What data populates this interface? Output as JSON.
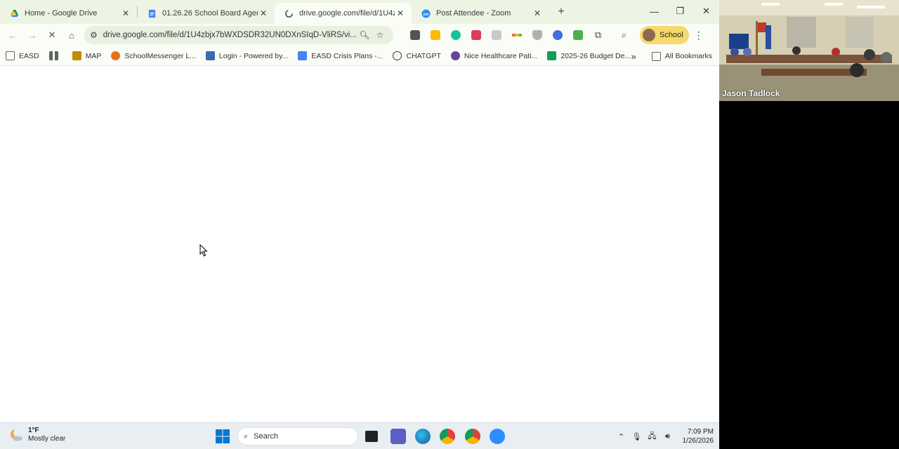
{
  "tabs": [
    {
      "title": "Home - Google Drive",
      "icon": "google-drive-icon",
      "color": "#f4b400",
      "active": false
    },
    {
      "title": "01.26.26 School Board Agenda",
      "icon": "google-docs-icon",
      "color": "#4285f4",
      "active": false
    },
    {
      "title": "drive.google.com/file/d/1U4zb",
      "icon": "loading-icon",
      "color": "#5f6368",
      "active": true
    },
    {
      "title": "Post Attendee - Zoom",
      "icon": "zoom-icon",
      "color": "#2d8cff",
      "active": false
    }
  ],
  "toolbar": {
    "url": "drive.google.com/file/d/1U4zbjx7bWXDSDR32UN0DXnSIqD-VliRS/vi...",
    "profile_label": "School"
  },
  "bookmarks": [
    {
      "label": "EASD",
      "icon": "folder-bookmark-icon",
      "color": "#5f6368"
    },
    {
      "label": "",
      "icon": "apps-grid-icon",
      "color": "#5f6368"
    },
    {
      "label": "MAP",
      "icon": "map-icon",
      "color": "#c48a00"
    },
    {
      "label": "SchoolMessenger L...",
      "icon": "schoolmessenger-icon",
      "color": "#e8711a"
    },
    {
      "label": "Login - Powered by...",
      "icon": "login-icon",
      "color": "#3b6ab0"
    },
    {
      "label": "EASD Crisis Plans -...",
      "icon": "docs-icon",
      "color": "#4285f4"
    },
    {
      "label": "CHATGPT",
      "icon": "chatgpt-icon",
      "color": "#333333"
    },
    {
      "label": "Nice Healthcare Pati...",
      "icon": "nice-healthcare-icon",
      "color": "#6a3fa0"
    },
    {
      "label": "2025-26 Budget De...",
      "icon": "sheets-icon",
      "color": "#0f9d58"
    }
  ],
  "bookmarks_more": "»",
  "all_bookmarks_label": "All Bookmarks",
  "video": {
    "participant_name": "Jason Tadlock"
  },
  "taskbar": {
    "temperature": "1°F",
    "condition": "Mostly clear",
    "search_label": "Search",
    "time": "7:09 PM",
    "date": "1/26/2026"
  }
}
